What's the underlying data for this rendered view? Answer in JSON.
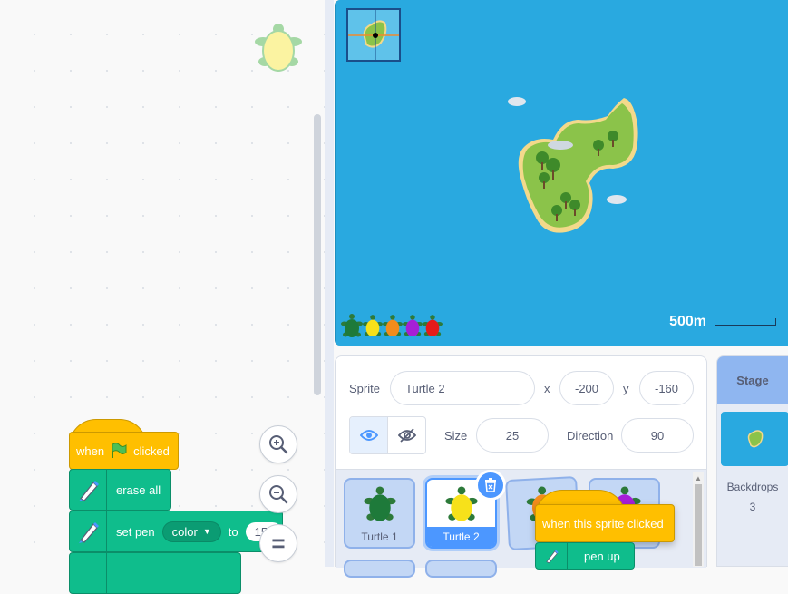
{
  "blocks": {
    "hat_when": "when",
    "hat_clicked": "clicked",
    "erase_all": "erase all",
    "set_pen": "set pen",
    "set_pen_param": "color",
    "set_pen_to": "to",
    "set_pen_value": "15"
  },
  "stage": {
    "scale_label": "500m",
    "accent_color": "#29a9e0"
  },
  "sprite_info": {
    "sprite_label": "Sprite",
    "sprite_name": "Turtle 2",
    "x_label": "x",
    "x_value": "-200",
    "y_label": "y",
    "y_value": "-160",
    "size_label": "Size",
    "size_value": "25",
    "direction_label": "Direction",
    "direction_value": "90"
  },
  "sprites": [
    {
      "name": "Turtle 1",
      "color": "#1e7a3a"
    },
    {
      "name": "Turtle 2",
      "color": "#f7e11a",
      "selected": true
    },
    {
      "name": "Tu",
      "color": "#f28c1c"
    },
    {
      "name": "",
      "color": "#a61fd6"
    }
  ],
  "drag_ghost": {
    "hat_label": "when this sprite clicked",
    "cmd_label": "pen up"
  },
  "stage_panel": {
    "title": "Stage",
    "backdrops_label": "Backdrops",
    "backdrops_count": "3"
  },
  "turtle_colors": [
    "#1e7a3a",
    "#f7e11a",
    "#f28c1c",
    "#a61fd6",
    "#e51a1a"
  ]
}
